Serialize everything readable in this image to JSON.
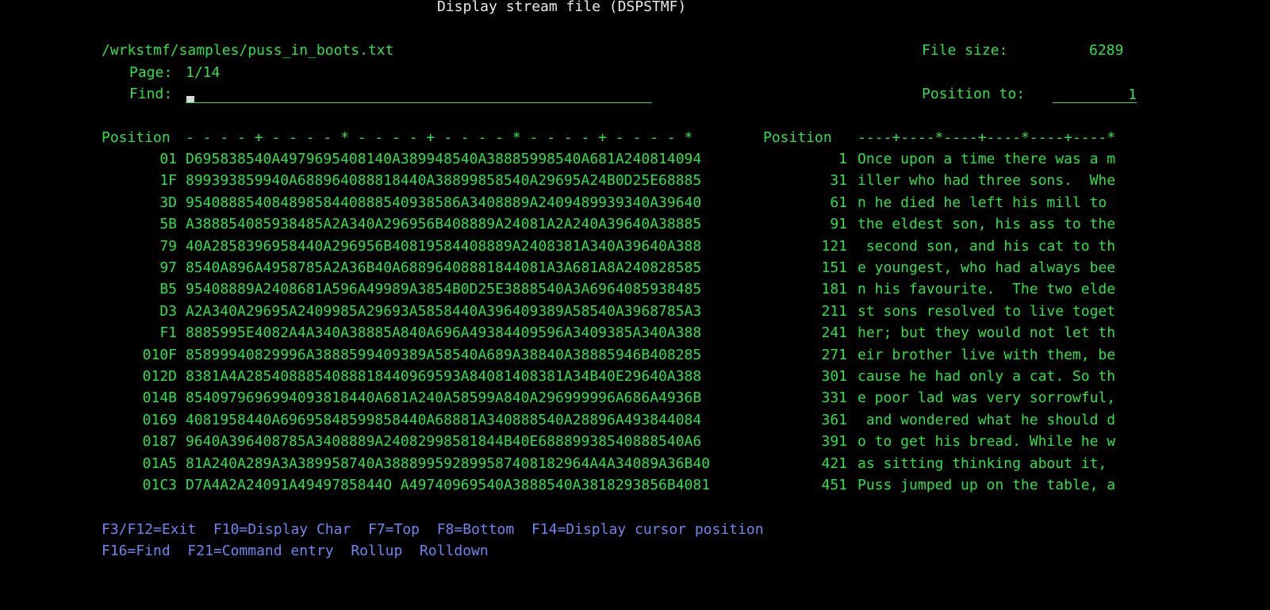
{
  "header": {
    "title": "Display stream file (DSPSTMF)"
  },
  "file": {
    "path": "/wrkstmf/samples/puss_in_boots.txt",
    "size_label": "File size:",
    "size_value": "6289",
    "page_label": "Page:",
    "page_value": "1/14",
    "find_label": "Find:",
    "find_value": "",
    "position_to_label": "Position to:",
    "position_to_value": "1"
  },
  "ruler": {
    "left_label": "Position",
    "left_ruler": "- - - - + - - - - * - - - - + - - - - * - - - - + - - - - *",
    "right_label": "Position",
    "right_ruler": "----+----*----+----*----+----*"
  },
  "rows": [
    {
      "hexpos": "01",
      "hex": "D695838540A4979695408140A389948540A38885998540A681A240814094",
      "pos": "1",
      "text": "Once upon a time there was a m"
    },
    {
      "hexpos": "1F",
      "hex": "899393859940A688964088818440A38899858540A29695A24B0D25E68885",
      "pos": "31",
      "text": "iller who had three sons.  Whe"
    },
    {
      "hexpos": "3D",
      "hex": "95408885408489858440888540938586A3408889A2409489939340A39640",
      "pos": "61",
      "text": "n he died he left his mill to "
    },
    {
      "hexpos": "5B",
      "hex": "A388854085938485A2A340A296956B408889A24081A2A240A39640A38885",
      "pos": "91",
      "text": "the eldest son, his ass to the"
    },
    {
      "hexpos": "79",
      "hex": "40A2858396958440A296956B40819584408889A2408381A340A39640A388",
      "pos": "121",
      "text": " second son, and his cat to th"
    },
    {
      "hexpos": "97",
      "hex": "8540A896A4958785A2A36B40A68896408881844081A3A681A8A240828585",
      "pos": "151",
      "text": "e youngest, who had always bee"
    },
    {
      "hexpos": "B5",
      "hex": "95408889A2408681A596A49989A3854B0D25E3888540A3A6964085938485",
      "pos": "181",
      "text": "n his favourite.  The two elde"
    },
    {
      "hexpos": "D3",
      "hex": "A2A340A29695A2409985A29693A5858440A396409389A58540A3968785A3",
      "pos": "211",
      "text": "st sons resolved to live toget"
    },
    {
      "hexpos": "F1",
      "hex": "8885995E4082A4A340A38885A840A696A49384409596A3409385A340A388",
      "pos": "241",
      "text": "her; but they would not let th"
    },
    {
      "hexpos": "010F",
      "hex": "85899940829996A3888599409389A58540A689A38840A38885946B408285",
      "pos": "271",
      "text": "eir brother live with them, be"
    },
    {
      "hexpos": "012D",
      "hex": "8381A4A2854088854088818440969593A84081408381A34B40E29640A388",
      "pos": "301",
      "text": "cause he had only a cat. So th"
    },
    {
      "hexpos": "014B",
      "hex": "8540979696994093818440A681A240A58599A840A296999996A686A4936B",
      "pos": "331",
      "text": "e poor lad was very sorrowful,"
    },
    {
      "hexpos": "0169",
      "hex": "4081958440A69695848599858440A68881A340888540A28896A493844084",
      "pos": "361",
      "text": " and wondered what he should d"
    },
    {
      "hexpos": "0187",
      "hex": "9640A396408785A3408889A24082998581844B40E68889938540888540A6",
      "pos": "391",
      "text": "o to get his bread. While he w"
    },
    {
      "hexpos": "01A5",
      "hex": "81A240A289A3A389958740A388899592899587408182964A4A34089A36B40",
      "pos": "421",
      "text": "as sitting thinking about it, "
    },
    {
      "hexpos": "01C3",
      "hex": "D7A4A2A24091A4949785844O A49740969540A3888540A3818293856B4081",
      "pos": "451",
      "text": "Puss jumped up on the table, a"
    }
  ],
  "fkeys": {
    "line1": [
      {
        "label": "F3/F12=Exit"
      },
      {
        "label": "F10=Display Char"
      },
      {
        "label": "F7=Top"
      },
      {
        "label": "F8=Bottom"
      },
      {
        "label": "F14=Display cursor position"
      }
    ],
    "line2": [
      {
        "label": "F16=Find"
      },
      {
        "label": "F21=Command entry"
      },
      {
        "label": "Rollup"
      },
      {
        "label": "Rolldown"
      }
    ]
  },
  "colors": {
    "background": "#000000",
    "field_text": "#2ee04a",
    "title_text": "#e8e8e8",
    "function_keys": "#6e87f0"
  }
}
